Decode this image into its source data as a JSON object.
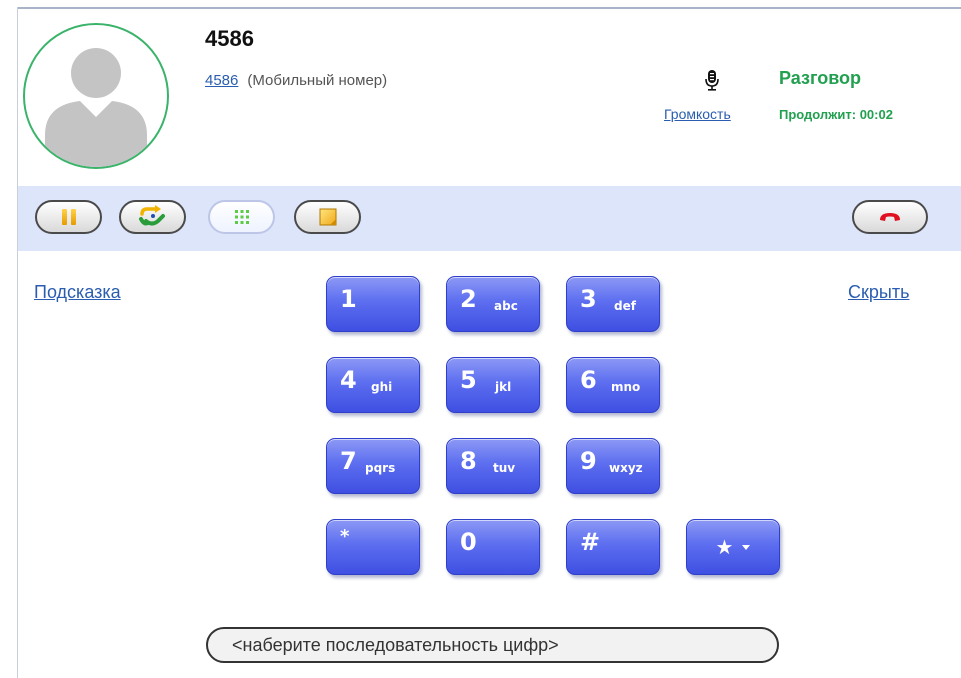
{
  "contact": {
    "name": "4586",
    "number_link": "4586",
    "number_type": "(Мобильный номер)"
  },
  "audio": {
    "volume_label": "Громкость"
  },
  "call": {
    "status": "Разговор",
    "duration": "Продолжит: 00:02"
  },
  "toolbar": {
    "buttons": [
      {
        "name": "hold",
        "icon": "pause-icon"
      },
      {
        "name": "transfer",
        "icon": "transfer-icon"
      },
      {
        "name": "keypad",
        "icon": "keypad-grid-icon",
        "active": true
      },
      {
        "name": "notes",
        "icon": "note-icon"
      },
      {
        "name": "hangup",
        "icon": "hangup-phone-icon"
      }
    ]
  },
  "links": {
    "hint": "Подсказка",
    "hide": "Скрыть"
  },
  "keypad": {
    "keys": [
      {
        "digit": "1",
        "letters": ""
      },
      {
        "digit": "2",
        "letters": "abc"
      },
      {
        "digit": "3",
        "letters": "def"
      },
      {
        "digit": "4",
        "letters": "ghi"
      },
      {
        "digit": "5",
        "letters": "jkl"
      },
      {
        "digit": "6",
        "letters": "mno"
      },
      {
        "digit": "7",
        "letters": "pqrs"
      },
      {
        "digit": "8",
        "letters": "tuv"
      },
      {
        "digit": "9",
        "letters": "wxyz"
      },
      {
        "digit": "*",
        "letters": ""
      },
      {
        "digit": "0",
        "letters": ""
      },
      {
        "digit": "#",
        "letters": ""
      }
    ],
    "star_menu_symbol": "★"
  },
  "digits_input": {
    "placeholder": "<наберите последовательность цифр>",
    "value": ""
  },
  "colors": {
    "accent_green": "#22a050",
    "link_blue": "#2a5db0",
    "toolbar_bg": "#dde5fb",
    "key_blue": "#5d6ef0",
    "hangup_red": "#e01020"
  }
}
